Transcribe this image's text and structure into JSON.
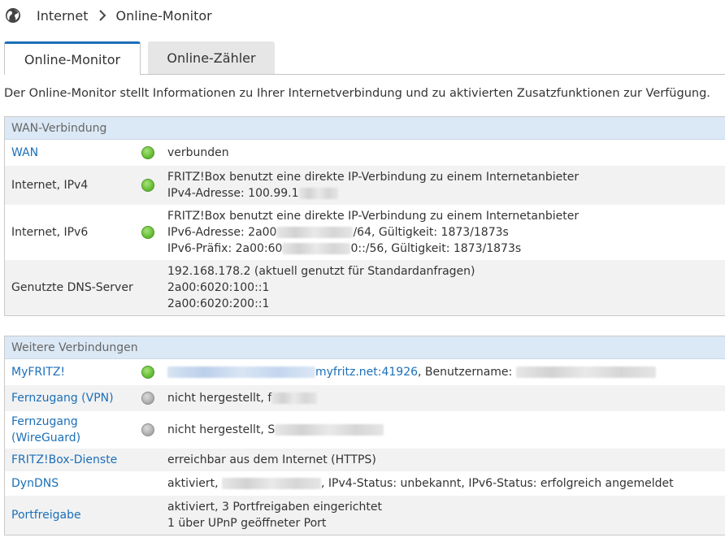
{
  "breadcrumb": {
    "root": "Internet",
    "current": "Online-Monitor"
  },
  "tabs": [
    {
      "label": "Online-Monitor"
    },
    {
      "label": "Online-Zähler"
    }
  ],
  "intro": "Der Online-Monitor stellt Informationen zu Ihrer Internetverbindung und zu aktivierten Zusatzfunktionen zur Verfügung.",
  "wan": {
    "heading": "WAN-Verbindung",
    "rows": [
      {
        "label": "WAN",
        "status": "verbunden"
      },
      {
        "label": "Internet, IPv4",
        "line1": "FRITZ!Box benutzt eine direkte IP-Verbindung zu einem Internetanbieter",
        "line2": "IPv4-Adresse: 100.99.1"
      },
      {
        "label": "Internet, IPv6",
        "line1": "FRITZ!Box benutzt eine direkte IP-Verbindung zu einem Internetanbieter",
        "line2a": "IPv6-Adresse: 2a00",
        "line2b": "/64, Gültigkeit: 1873/1873s",
        "line3a": "IPv6-Präfix: 2a00:60",
        "line3b": "0::/56, Gültigkeit: 1873/1873s"
      },
      {
        "label": "Genutzte DNS-Server",
        "line1": "192.168.178.2 (aktuell genutzt für Standardanfragen)",
        "line2": "2a00:6020:100::1",
        "line3": "2a00:6020:200::1"
      }
    ]
  },
  "more": {
    "heading": "Weitere Verbindungen",
    "rows": [
      {
        "label": "MyFRITZ!",
        "link_suffix": "myfritz.net:41926",
        "text": ", Benutzername: "
      },
      {
        "label": "Fernzugang (VPN)",
        "text": "nicht hergestellt, f"
      },
      {
        "label_line1": "Fernzugang",
        "label_line2": "(WireGuard)",
        "text": "nicht hergestellt, S"
      },
      {
        "label": "FRITZ!Box-Dienste",
        "text": "erreichbar aus dem Internet (HTTPS)"
      },
      {
        "label": "DynDNS",
        "text_a": "aktiviert, ",
        "text_b": ", IPv4-Status: unbekannt, IPv6-Status: erfolgreich angemeldet"
      },
      {
        "label": "Portfreigabe",
        "line1": "aktiviert, 3 Portfreigaben eingerichtet",
        "line2": "1 über UPnP geöffneter Port"
      }
    ]
  },
  "colors": {
    "accent": "#1c6fb8",
    "header_bg": "#dbe8f5",
    "led_on": "#6cc23b",
    "led_off": "#b0b0b0"
  },
  "icons": {
    "breadcrumb": "globe-icon",
    "separator": "chevron-right-icon"
  }
}
